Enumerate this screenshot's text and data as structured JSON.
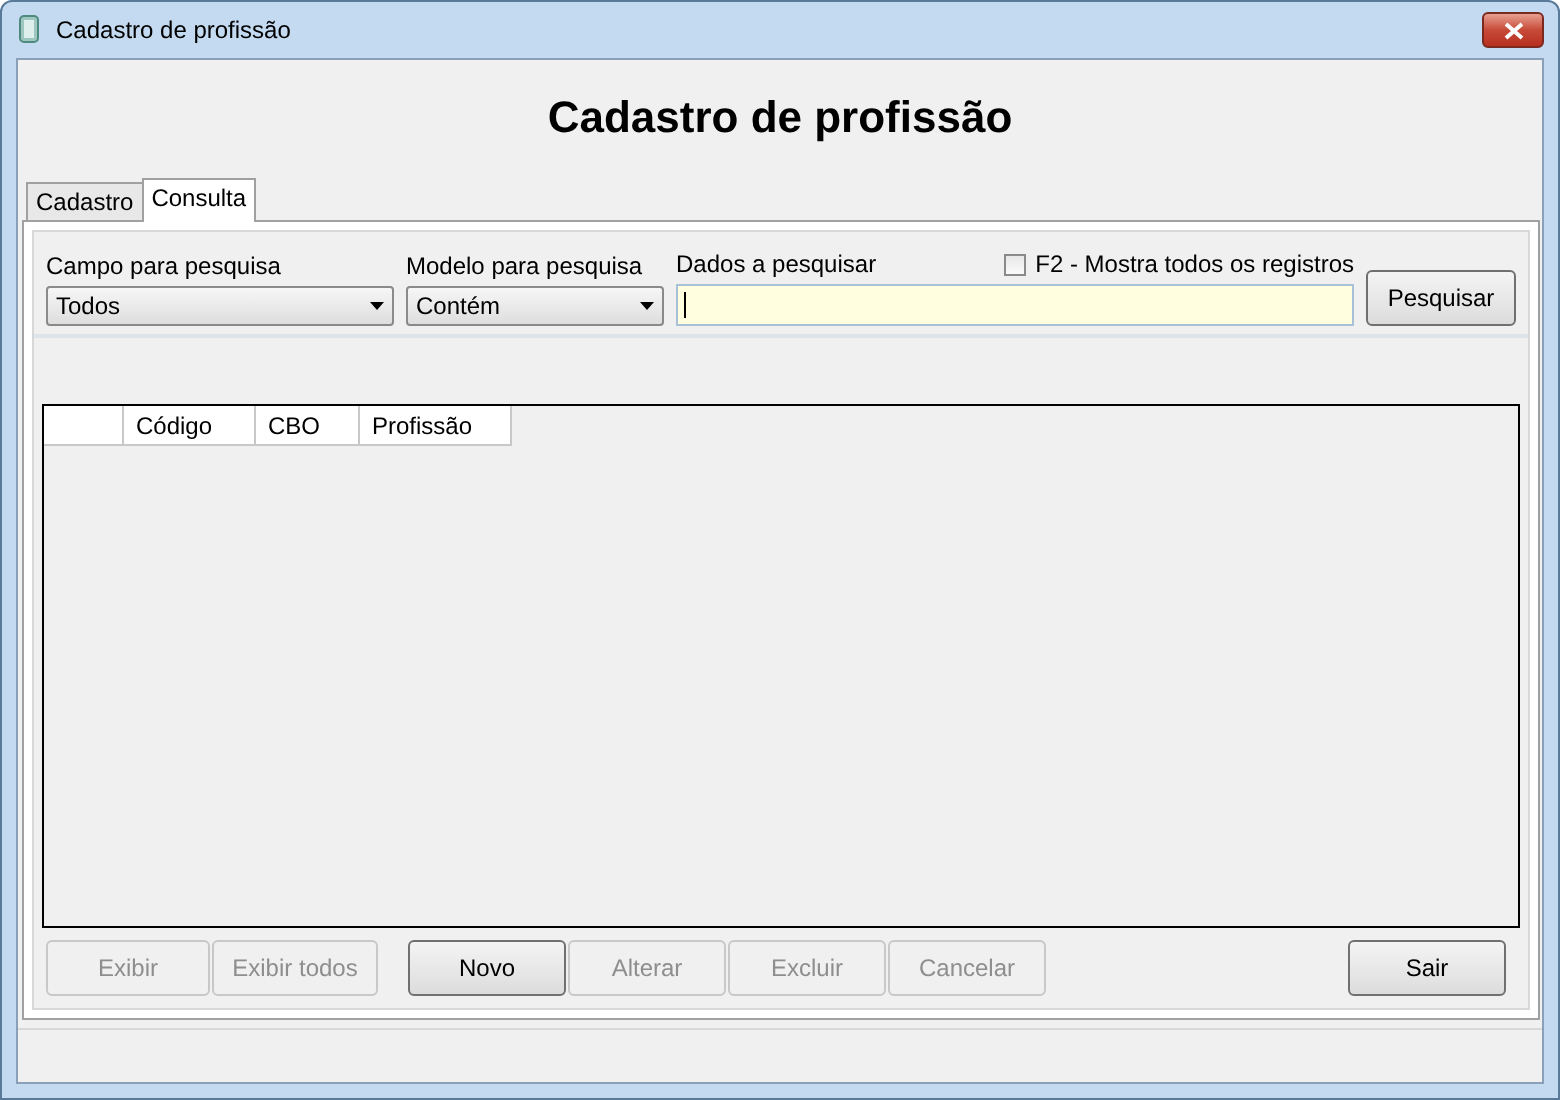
{
  "window": {
    "title": "Cadastro de profissão"
  },
  "heading": "Cadastro de profissão",
  "tabs": [
    {
      "label": "Cadastro",
      "selected": false
    },
    {
      "label": "Consulta",
      "selected": true
    }
  ],
  "search": {
    "field_label": "Campo para pesquisa",
    "field_value": "Todos",
    "model_label": "Modelo para pesquisa",
    "model_value": "Contém",
    "data_label": "Dados a pesquisar",
    "show_all": {
      "label": "F2 - Mostra todos os registros",
      "checked": false
    },
    "button": "Pesquisar"
  },
  "table": {
    "columns": [
      "Código",
      "CBO",
      "Profissão"
    ]
  },
  "button_groups": [
    {
      "buttons": [
        {
          "label": "Exibir",
          "disabled": true
        },
        {
          "label": "Exibir todos",
          "disabled": true
        }
      ]
    },
    {
      "buttons": [
        {
          "label": "Novo",
          "disabled": false
        },
        {
          "label": "Alterar",
          "disabled": true
        },
        {
          "label": "Excluir",
          "disabled": true
        },
        {
          "label": "Cancelar",
          "disabled": true
        }
      ]
    },
    {
      "buttons": [
        {
          "label": "Sair",
          "disabled": false
        }
      ]
    }
  ]
}
